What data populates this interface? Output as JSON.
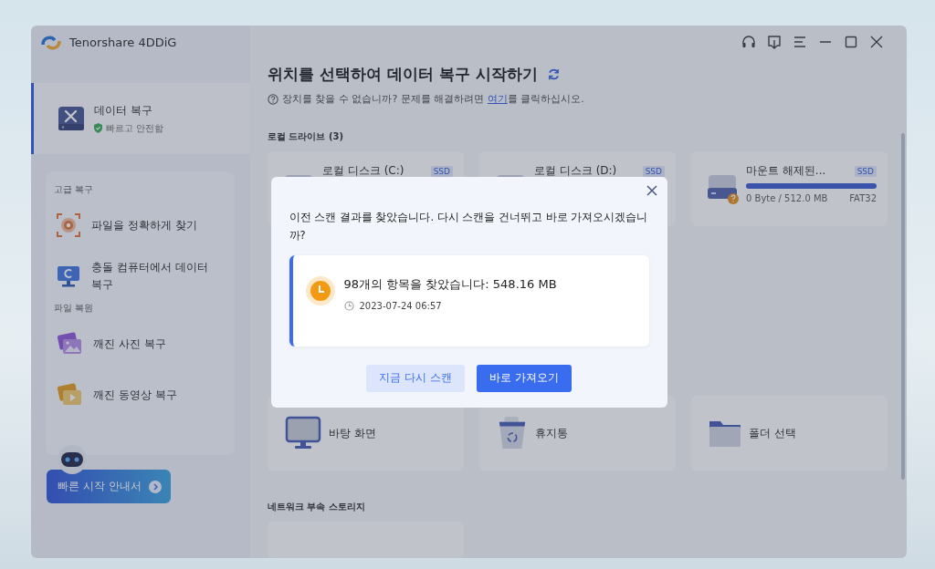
{
  "app": {
    "title": "Tenorshare 4DDiG"
  },
  "sidebar": {
    "main_item": {
      "label": "데이터 복구",
      "sub": "빠르고 안전함",
      "selected": true
    },
    "groups": [
      {
        "heading": "고급 복구",
        "items": [
          {
            "label": "파일을 정확하게 찾기",
            "kind": "target"
          },
          {
            "label": "충돌 컴퓨터에서 데이터 복구",
            "kind": "computer"
          }
        ]
      },
      {
        "heading": "파일 복원",
        "items": [
          {
            "label": "깨진 사진 복구",
            "kind": "photo"
          },
          {
            "label": "깨진 동영상 복구",
            "kind": "video"
          }
        ]
      }
    ],
    "guide_button": "빠른 시작 안내서"
  },
  "main": {
    "title": "위치를 선택하여 데이터 복구 시작하기",
    "help_text": "장치를 찾을 수 없습니까? 문제를 해결하려면 ",
    "help_link": "여기",
    "help_after": "를 클릭하십시오.",
    "local_heading": "로컬 드라이브 (3)",
    "drives": [
      {
        "name": "로컬 디스크 (C:)",
        "tag": "SSD"
      },
      {
        "name": "로컬 디스크 (D:)",
        "tag": "SSD"
      },
      {
        "name": "마운트 해제된...",
        "tag": "SSD",
        "level": 1,
        "usage": "0 Byte / 512.0 MB",
        "fs": "FAT32"
      }
    ],
    "locations": [
      {
        "label": "바탕 화면",
        "kind": "desktop"
      },
      {
        "label": "휴지통",
        "kind": "trash"
      },
      {
        "label": "폴더 선택",
        "kind": "folder"
      }
    ],
    "network_heading": "네트워크 부속 스토리지"
  },
  "dialog": {
    "message": "이전 스캔 결과를 찾았습니다. 다시 스캔을 건너뛰고 바로 가져오시겠습니까?",
    "result": "98개의 항목을 찾았습니다: 548.16 MB",
    "time": "2023-07-24 06:57",
    "buttons": [
      {
        "label": "지금 다시 스캔",
        "kind": "secondary"
      },
      {
        "label": "바로 가져오기",
        "kind": "primary"
      }
    ]
  }
}
